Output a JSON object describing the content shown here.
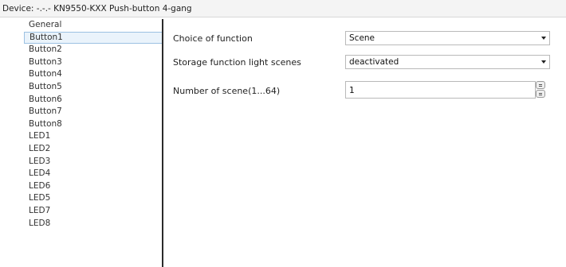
{
  "title": "Device: -.-.-  KN9550-KXX Push-button 4-gang",
  "sidebar": {
    "items": [
      {
        "label": "General",
        "active": false
      },
      {
        "label": "Button1",
        "active": true
      },
      {
        "label": "Button2",
        "active": false
      },
      {
        "label": "Button3",
        "active": false
      },
      {
        "label": "Button4",
        "active": false
      },
      {
        "label": "Button5",
        "active": false
      },
      {
        "label": "Button6",
        "active": false
      },
      {
        "label": "Button7",
        "active": false
      },
      {
        "label": "Button8",
        "active": false
      },
      {
        "label": "LED1",
        "active": false
      },
      {
        "label": "LED2",
        "active": false
      },
      {
        "label": "LED3",
        "active": false
      },
      {
        "label": "LED4",
        "active": false
      },
      {
        "label": "LED6",
        "active": false
      },
      {
        "label": "LED5",
        "active": false
      },
      {
        "label": "LED7",
        "active": false
      },
      {
        "label": "LED8",
        "active": false
      }
    ]
  },
  "params": {
    "choice_of_function": {
      "label": "Choice of function",
      "value": "Scene"
    },
    "storage_function": {
      "label": "Storage function light scenes",
      "value": "deactivated"
    },
    "number_of_scene": {
      "label": "Number of scene(1...64)",
      "value": "1"
    }
  },
  "icons": {
    "dropdown": "chevron-down-icon",
    "spinner_up": "spin-up-icon",
    "spinner_down": "spin-down-icon"
  }
}
